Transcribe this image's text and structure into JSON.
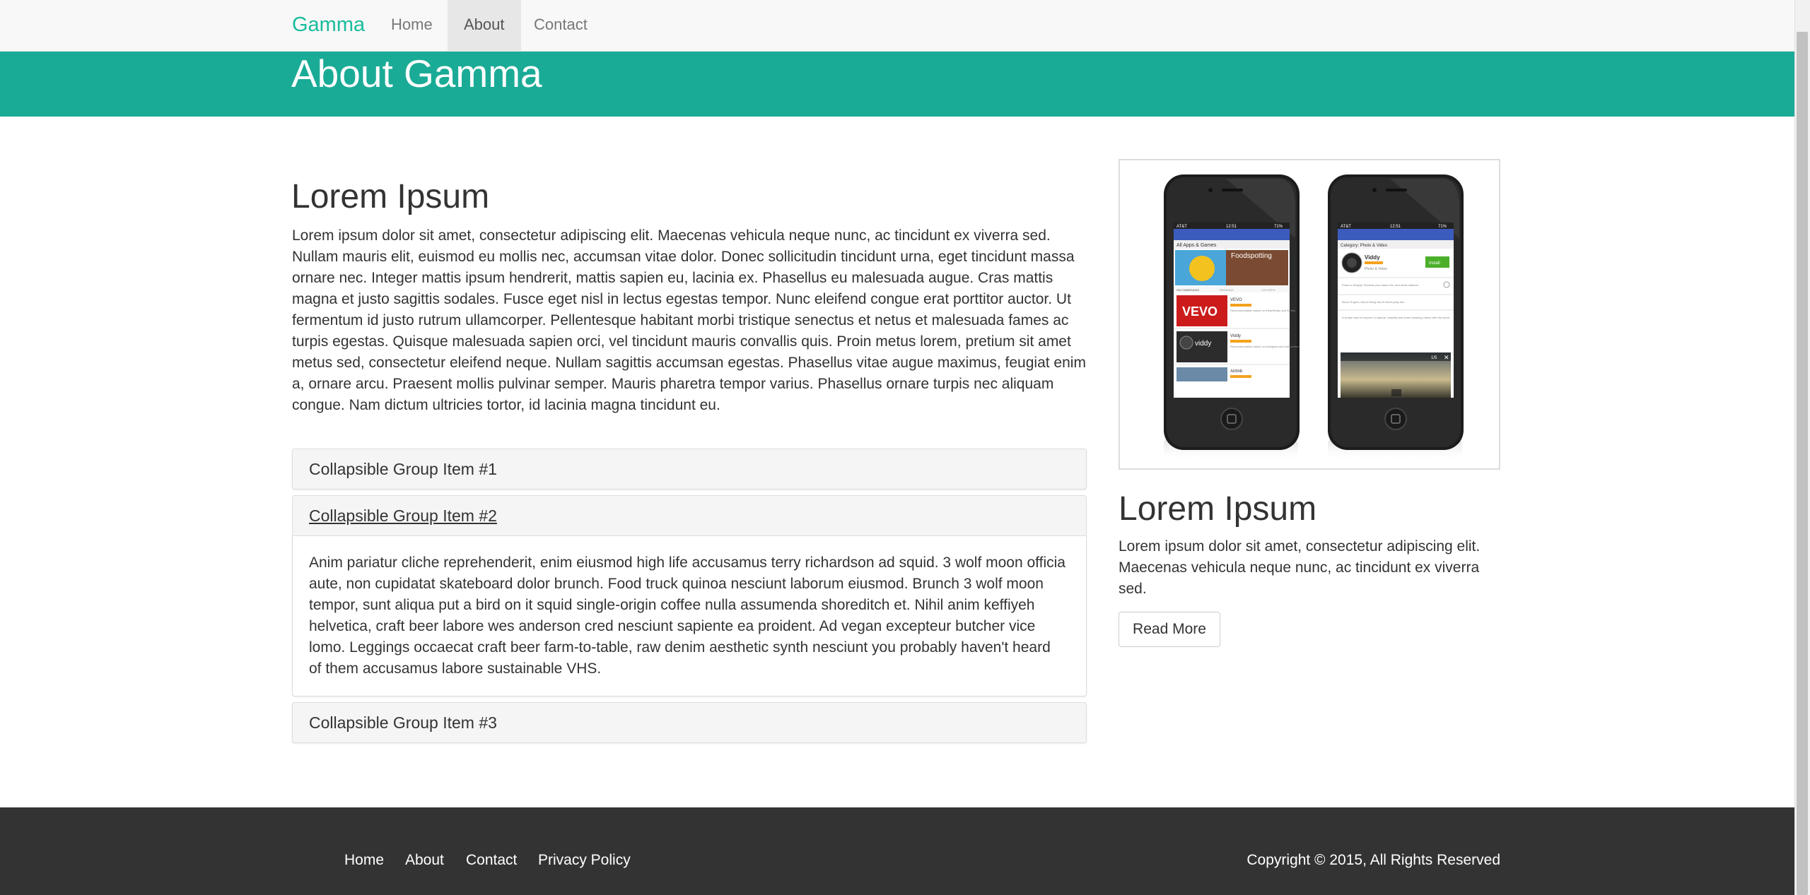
{
  "nav": {
    "brand": "Gamma",
    "items": [
      {
        "label": "Home",
        "active": false
      },
      {
        "label": "About",
        "active": true
      },
      {
        "label": "Contact",
        "active": false
      }
    ]
  },
  "hero": {
    "title": "About Gamma"
  },
  "main": {
    "title": "Lorem Ipsum",
    "paragraph": "Lorem ipsum dolor sit amet, consectetur adipiscing elit. Maecenas vehicula neque nunc, ac tincidunt ex viverra sed. Nullam mauris elit, euismod eu mollis nec, accumsan vitae dolor. Donec sollicitudin tincidunt urna, eget tincidunt massa ornare nec. Integer mattis ipsum hendrerit, mattis sapien eu, lacinia ex. Phasellus eu malesuada augue. Cras mattis magna et justo sagittis sodales. Fusce eget nisl in lectus egestas tempor. Nunc eleifend congue erat porttitor auctor. Ut fermentum id justo rutrum ullamcorper. Pellentesque habitant morbi tristique senectus et netus et malesuada fames ac turpis egestas. Quisque malesuada sapien orci, vel tincidunt mauris convallis quis. Proin metus lorem, pretium sit amet metus sed, consectetur eleifend neque. Nullam sagittis accumsan egestas. Phasellus vitae augue maximus, feugiat enim a, ornare arcu. Praesent mollis pulvinar semper. Mauris pharetra tempor varius. Phasellus ornare turpis nec aliquam congue. Nam dictum ultricies tortor, id lacinia magna tincidunt eu."
  },
  "accordion": {
    "items": [
      {
        "title": "Collapsible Group Item #1",
        "expanded": false
      },
      {
        "title": "Collapsible Group Item #2",
        "expanded": true,
        "body": "Anim pariatur cliche reprehenderit, enim eiusmod high life accusamus terry richardson ad squid. 3 wolf moon officia aute, non cupidatat skateboard dolor brunch. Food truck quinoa nesciunt laborum eiusmod. Brunch 3 wolf moon tempor, sunt aliqua put a bird on it squid single-origin coffee nulla assumenda shoreditch et. Nihil anim keffiyeh helvetica, craft beer labore wes anderson cred nesciunt sapiente ea proident. Ad vegan excepteur butcher vice lomo. Leggings occaecat craft beer farm-to-table, raw denim aesthetic synth nesciunt you probably haven't heard of them accusamus labore sustainable VHS."
      },
      {
        "title": "Collapsible Group Item #3",
        "expanded": false
      }
    ]
  },
  "sidebar": {
    "image": {
      "phone1": {
        "status": "AT&T",
        "time": "12:51",
        "battery": "71%",
        "category": "All Apps & Games",
        "tabs": [
          "RECOMMENDED",
          "TRENDING",
          "TOP APPS"
        ],
        "banner": "Foodspotting",
        "apps": [
          {
            "name": "VEVO",
            "logo": "VEVO",
            "text": "Recommendation based on iHeartRadio and Spotify"
          },
          {
            "name": "Viddy",
            "logo": "viddy",
            "text": "Recommendation based on Instagram and Dailymotion"
          },
          {
            "name": "Airbnb",
            "logo": "",
            "text": ""
          }
        ]
      },
      "phone2": {
        "status": "AT&T",
        "time": "12:51",
        "battery": "71%",
        "category": "Category: Photo & Video",
        "app": {
          "name": "Viddy",
          "sub": "Photo & Video",
          "button": "Install"
        },
        "notes": [
          "Posts to Ebaydy. Reviews your basic info, and email address.",
          "Bruce Rogers, Aaron Brady and 8 others play this",
          "A simple way for anyone to capture, beautify and share amazing videos with the world."
        ],
        "video": {
          "counter": "1/5"
        }
      }
    },
    "title": "Lorem Ipsum",
    "paragraph": "Lorem ipsum dolor sit amet, consectetur adipiscing elit. Maecenas vehicula neque nunc, ac tincidunt ex viverra sed.",
    "button": "Read More"
  },
  "footer": {
    "links": [
      "Home",
      "About",
      "Contact",
      "Privacy Policy"
    ],
    "copyright": "Copyright © 2015, All Rights Reserved"
  },
  "colors": {
    "brand": "#18bc9c",
    "hero": "#1aab96",
    "footer": "#333333",
    "nav_bg": "#f8f8f8"
  }
}
